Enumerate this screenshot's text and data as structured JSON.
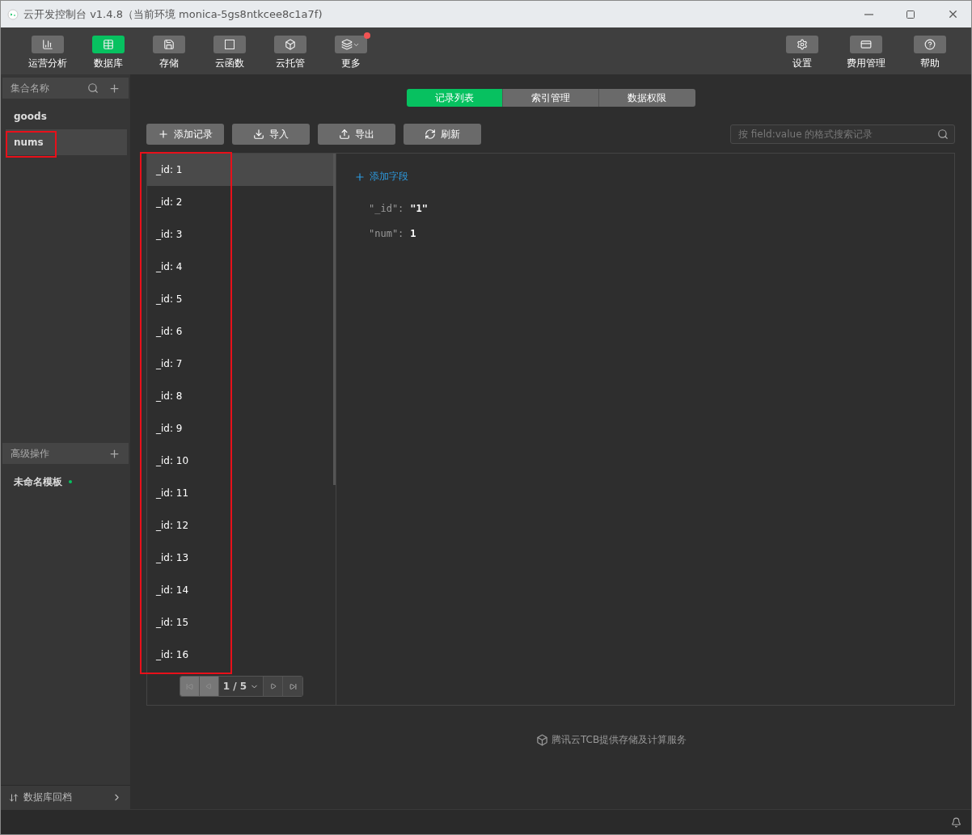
{
  "window": {
    "title": "云开发控制台 v1.4.8（当前环境 monica-5gs8ntkcee8c1a7f)"
  },
  "toolbar": {
    "left": [
      {
        "label": "运营分析",
        "selected": false,
        "badge": false
      },
      {
        "label": "数据库",
        "selected": true,
        "badge": false
      },
      {
        "label": "存储",
        "selected": false,
        "badge": false
      },
      {
        "label": "云函数",
        "selected": false,
        "badge": false
      },
      {
        "label": "云托管",
        "selected": false,
        "badge": false
      },
      {
        "label": "更多",
        "selected": false,
        "badge": true
      }
    ],
    "right": [
      {
        "label": "设置"
      },
      {
        "label": "费用管理"
      },
      {
        "label": "帮助"
      }
    ]
  },
  "sidebar": {
    "collections_title": "集合名称",
    "collections": [
      {
        "name": "goods",
        "selected": false
      },
      {
        "name": "nums",
        "selected": true
      }
    ],
    "advanced_title": "高级操作",
    "templates": [
      {
        "name": "未命名模板",
        "dot": true
      }
    ],
    "rollback": "数据库回档"
  },
  "tabs": [
    {
      "label": "记录列表",
      "selected": true
    },
    {
      "label": "索引管理",
      "selected": false
    },
    {
      "label": "数据权限",
      "selected": false
    }
  ],
  "actions": [
    {
      "label": "添加记录"
    },
    {
      "label": "导入"
    },
    {
      "label": "导出"
    },
    {
      "label": "刷新"
    }
  ],
  "search": {
    "placeholder": "按 field:value 的格式搜索记录"
  },
  "records": [
    {
      "label": "_id: 1",
      "selected": true
    },
    {
      "label": "_id: 2",
      "selected": false
    },
    {
      "label": "_id: 3",
      "selected": false
    },
    {
      "label": "_id: 4",
      "selected": false
    },
    {
      "label": "_id: 5",
      "selected": false
    },
    {
      "label": "_id: 6",
      "selected": false
    },
    {
      "label": "_id: 7",
      "selected": false
    },
    {
      "label": "_id: 8",
      "selected": false
    },
    {
      "label": "_id: 9",
      "selected": false
    },
    {
      "label": "_id: 10",
      "selected": false
    },
    {
      "label": "_id: 11",
      "selected": false
    },
    {
      "label": "_id: 12",
      "selected": false
    },
    {
      "label": "_id: 13",
      "selected": false
    },
    {
      "label": "_id: 14",
      "selected": false
    },
    {
      "label": "_id: 15",
      "selected": false
    },
    {
      "label": "_id: 16",
      "selected": false
    }
  ],
  "pager": {
    "page": "1 / 5",
    "first_disabled": true,
    "prev_disabled": true,
    "next_disabled": false,
    "last_disabled": false
  },
  "detail": {
    "add_field": "添加字段",
    "fields": [
      {
        "key": "\"_id\":",
        "value": "\"1\""
      },
      {
        "key": "\"num\":",
        "value": "1"
      }
    ]
  },
  "footer": "腾讯云TCB提供存储及计算服务"
}
